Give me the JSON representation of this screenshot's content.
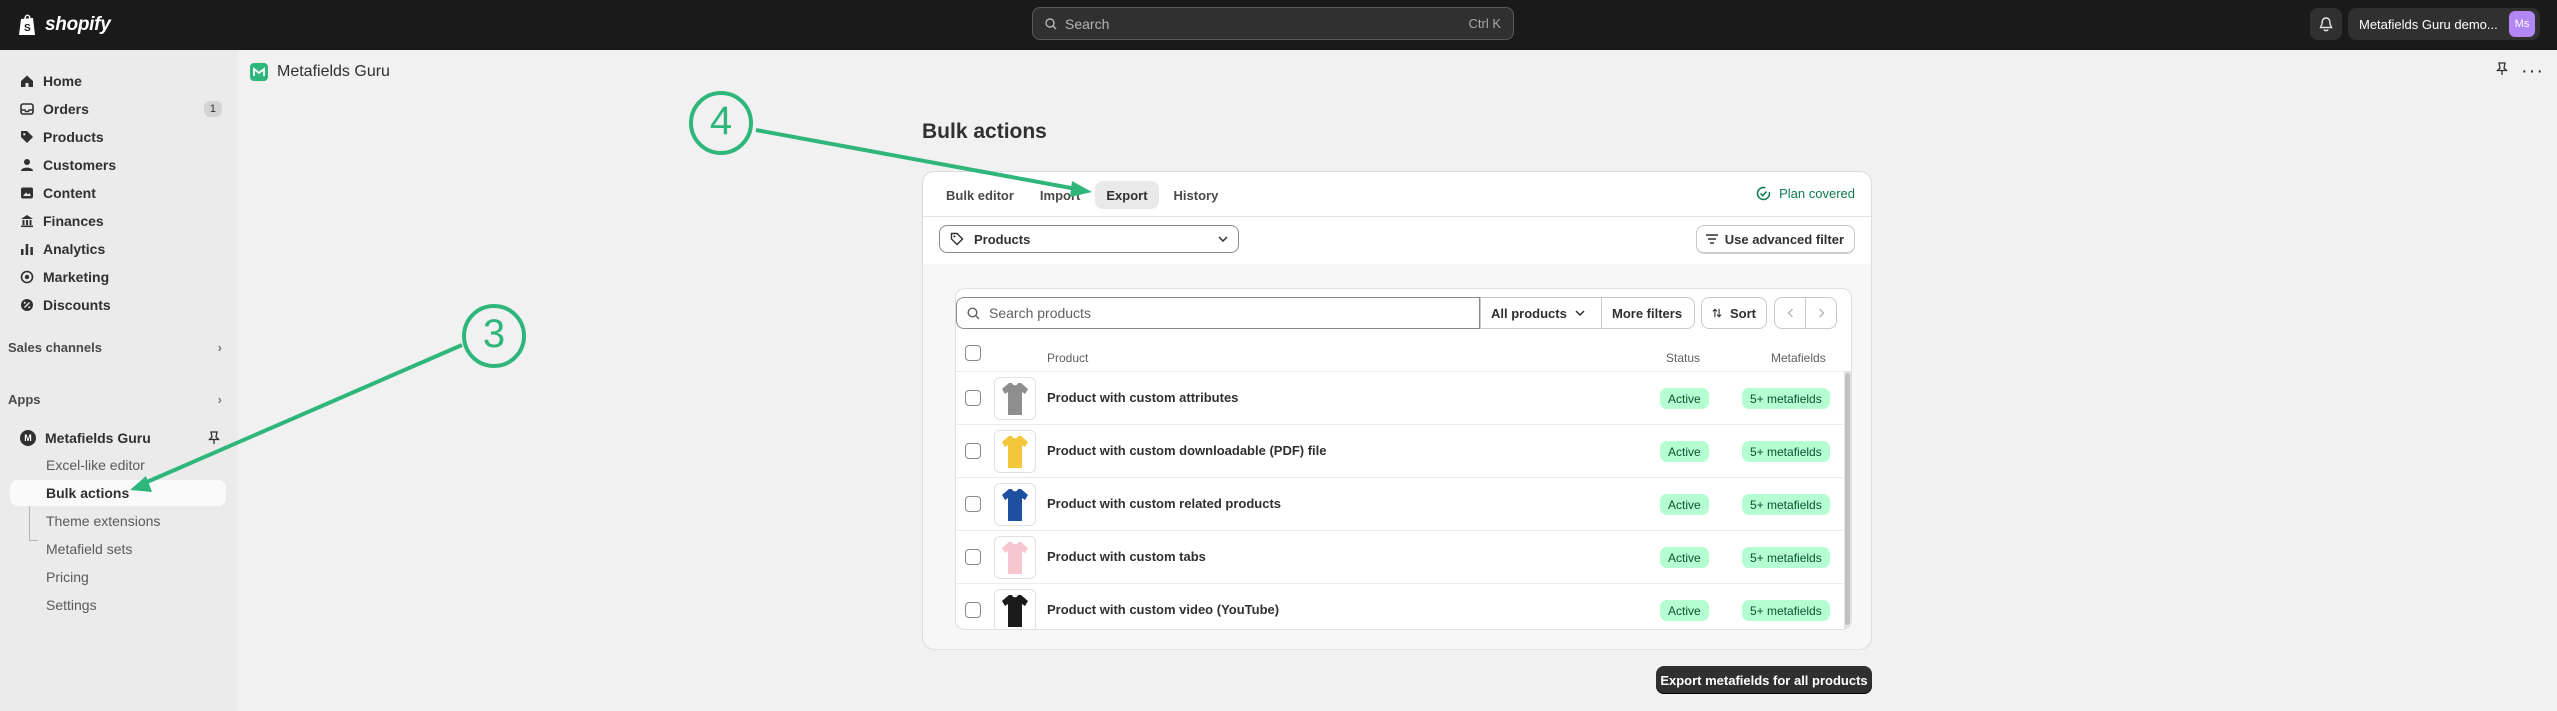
{
  "topbar": {
    "brand": "shopify",
    "search_placeholder": "Search",
    "search_shortcut": "Ctrl K",
    "store_name": "Metafields Guru demo...",
    "avatar_initials": "Ms"
  },
  "sidebar": {
    "items": [
      {
        "label": "Home",
        "icon": "home-icon"
      },
      {
        "label": "Orders",
        "icon": "orders-icon",
        "badge": "1"
      },
      {
        "label": "Products",
        "icon": "tag-icon"
      },
      {
        "label": "Customers",
        "icon": "person-icon"
      },
      {
        "label": "Content",
        "icon": "content-icon"
      },
      {
        "label": "Finances",
        "icon": "bank-icon"
      },
      {
        "label": "Analytics",
        "icon": "chart-icon"
      },
      {
        "label": "Marketing",
        "icon": "target-icon"
      },
      {
        "label": "Discounts",
        "icon": "discount-icon"
      }
    ],
    "sales_channels": "Sales channels",
    "apps": "Apps",
    "app_name": "Metafields Guru",
    "app_subitems": [
      "Excel-like editor",
      "Bulk actions",
      "Theme extensions",
      "Metafield sets",
      "Pricing",
      "Settings"
    ],
    "active_subitem": "Bulk actions"
  },
  "app_header": {
    "title": "Metafields Guru"
  },
  "page": {
    "title": "Bulk actions",
    "tabs": [
      "Bulk editor",
      "Import",
      "Export",
      "History"
    ],
    "active_tab": "Export",
    "plan_status": "Plan covered",
    "resource_select": "Products",
    "advanced_filter": "Use advanced filter",
    "search_placeholder": "Search products",
    "filter_all": "All products",
    "more_filters": "More filters",
    "sort": "Sort",
    "columns": {
      "product": "Product",
      "status": "Status",
      "metafields": "Metafields"
    },
    "rows": [
      {
        "name": "Product with custom attributes",
        "status": "Active",
        "metafields": "5+ metafields",
        "shirt_color": "#8e8e8e"
      },
      {
        "name": "Product with custom downloadable (PDF) file",
        "status": "Active",
        "metafields": "5+ metafields",
        "shirt_color": "#f3c63b"
      },
      {
        "name": "Product with custom related products",
        "status": "Active",
        "metafields": "5+ metafields",
        "shirt_color": "#1f4fa0"
      },
      {
        "name": "Product with custom tabs",
        "status": "Active",
        "metafields": "5+ metafields",
        "shirt_color": "#f7c7d0"
      },
      {
        "name": "Product with custom video (YouTube)",
        "status": "Active",
        "metafields": "5+ metafields",
        "shirt_color": "#1b1b1b"
      }
    ],
    "export_button": "Export metafields for all products"
  },
  "annotations": [
    {
      "label": "4",
      "color": "#2fb67a"
    },
    {
      "label": "3",
      "color": "#2fb67a"
    }
  ]
}
